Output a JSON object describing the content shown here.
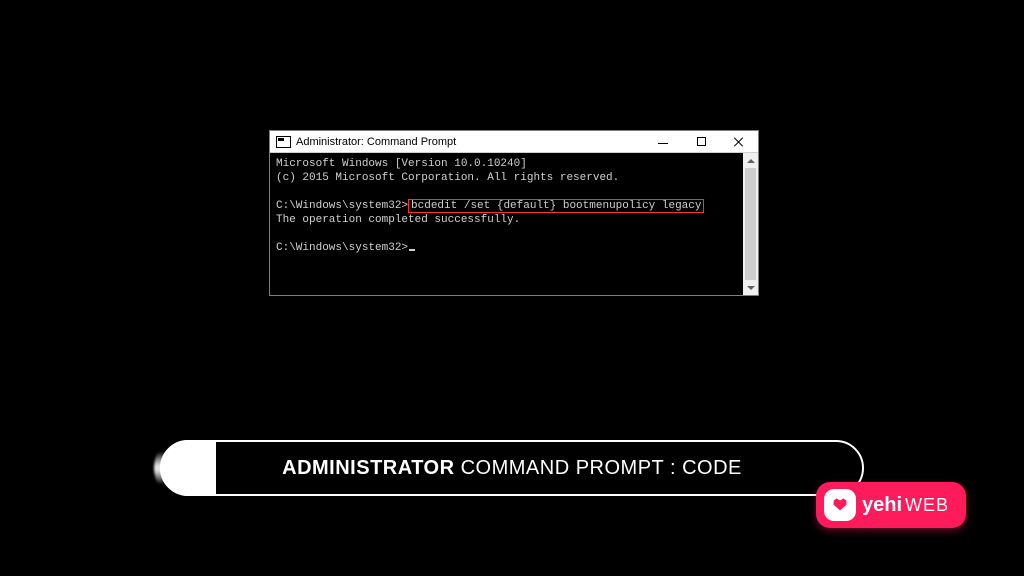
{
  "window": {
    "title": "Administrator: Command Prompt"
  },
  "terminal": {
    "line1": "Microsoft Windows [Version 10.0.10240]",
    "line2": "(c) 2015 Microsoft Corporation. All rights reserved.",
    "prompt1_prefix": "C:\\Windows\\system32>",
    "highlighted_cmd": "bcdedit /set {default} bootmenupolicy legacy",
    "result_line": "The operation completed successfully.",
    "prompt2": "C:\\Windows\\system32>"
  },
  "caption": {
    "bold": "ADMINISTRATOR",
    "rest": " COMMAND PROMPT : CODE"
  },
  "watermark": {
    "brand1": "yehi",
    "brand2": "WEB"
  }
}
